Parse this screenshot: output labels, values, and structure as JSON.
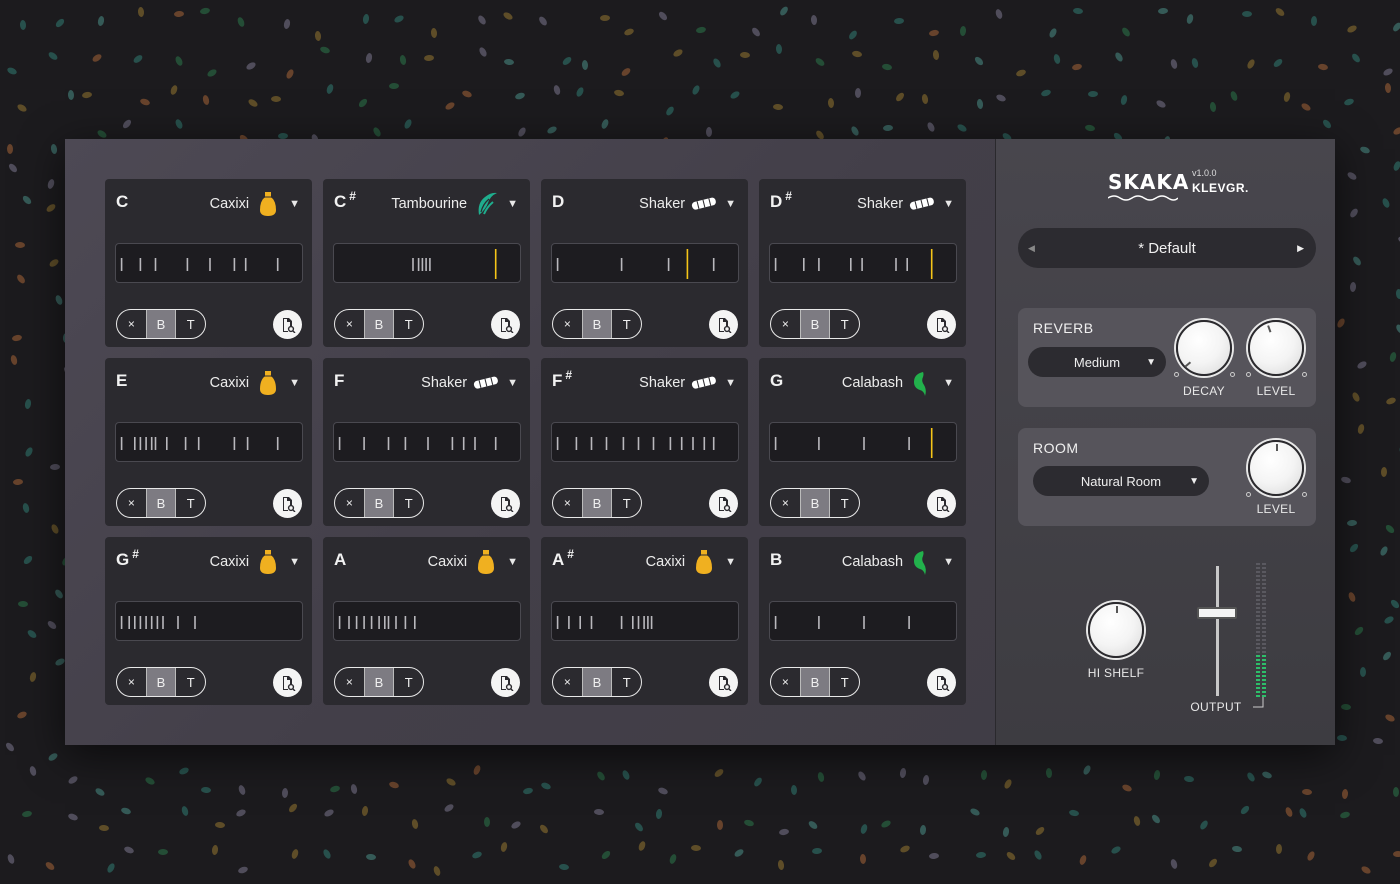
{
  "app": {
    "logo": "SKAKA",
    "version": "v1.0.0",
    "brand": "KLEVGR."
  },
  "preset": {
    "name": "* Default"
  },
  "pads": [
    {
      "note": "C",
      "sharp": "",
      "instrument": "Caxixi",
      "icon": "caxixi-icon",
      "color": "#f0b020",
      "ticks": [
        0.03,
        0.13,
        0.21,
        0.38,
        0.5,
        0.63,
        0.69,
        0.86
      ],
      "marker": null
    },
    {
      "note": "C",
      "sharp": "#",
      "instrument": "Tambourine",
      "icon": "tambourine-icon",
      "color": "#1fae8e",
      "ticks": [
        0.42,
        0.45,
        0.47,
        0.49,
        0.51
      ],
      "marker": 0.86
    },
    {
      "note": "D",
      "sharp": "",
      "instrument": "Shaker",
      "icon": "shaker-icon",
      "color": "#ffffff",
      "ticks": [
        0.03,
        0.37,
        0.62,
        0.86
      ],
      "marker": 0.72
    },
    {
      "note": "D",
      "sharp": "#",
      "instrument": "Shaker",
      "icon": "shaker-icon",
      "color": "#ffffff",
      "ticks": [
        0.03,
        0.18,
        0.26,
        0.43,
        0.49,
        0.67,
        0.73
      ],
      "marker": 0.86
    },
    {
      "note": "E",
      "sharp": "",
      "instrument": "Caxixi",
      "icon": "caxixi-icon",
      "color": "#f0b020",
      "ticks": [
        0.03,
        0.1,
        0.13,
        0.16,
        0.19,
        0.21,
        0.27,
        0.37,
        0.44,
        0.63,
        0.7,
        0.86
      ],
      "marker": null
    },
    {
      "note": "F",
      "sharp": "",
      "instrument": "Shaker",
      "icon": "shaker-icon",
      "color": "#ffffff",
      "ticks": [
        0.03,
        0.16,
        0.29,
        0.38,
        0.5,
        0.63,
        0.69,
        0.75,
        0.86
      ],
      "marker": null
    },
    {
      "note": "F",
      "sharp": "#",
      "instrument": "Shaker",
      "icon": "shaker-icon",
      "color": "#ffffff",
      "ticks": [
        0.03,
        0.13,
        0.21,
        0.29,
        0.38,
        0.46,
        0.54,
        0.63,
        0.69,
        0.75,
        0.81,
        0.86
      ],
      "marker": null
    },
    {
      "note": "G",
      "sharp": "",
      "instrument": "Calabash",
      "icon": "calabash-icon",
      "color": "#22b14c",
      "ticks": [
        0.03,
        0.26,
        0.5,
        0.74
      ],
      "marker": 0.86
    },
    {
      "note": "G",
      "sharp": "#",
      "instrument": "Caxixi",
      "icon": "caxixi-icon",
      "color": "#f0b020",
      "ticks": [
        0.03,
        0.07,
        0.1,
        0.13,
        0.16,
        0.19,
        0.22,
        0.25,
        0.33,
        0.42
      ],
      "marker": null
    },
    {
      "note": "A",
      "sharp": "",
      "instrument": "Caxixi",
      "icon": "caxixi-icon",
      "color": "#f0b020",
      "ticks": [
        0.03,
        0.08,
        0.12,
        0.16,
        0.2,
        0.24,
        0.27,
        0.29,
        0.33,
        0.38,
        0.43
      ],
      "marker": null
    },
    {
      "note": "A",
      "sharp": "#",
      "instrument": "Caxixi",
      "icon": "caxixi-icon",
      "color": "#f0b020",
      "ticks": [
        0.03,
        0.09,
        0.15,
        0.21,
        0.37,
        0.43,
        0.46,
        0.49,
        0.51,
        0.53
      ],
      "marker": null
    },
    {
      "note": "B",
      "sharp": "",
      "instrument": "Calabash",
      "icon": "calabash-icon",
      "color": "#22b14c",
      "ticks": [
        0.03,
        0.26,
        0.5,
        0.74
      ],
      "marker": null
    }
  ],
  "pad_buttons": {
    "mute": "×",
    "b": "B",
    "t": "T"
  },
  "reverb": {
    "title": "REVERB",
    "type": "Medium",
    "decay_label": "DECAY",
    "level_label": "LEVEL"
  },
  "room": {
    "title": "ROOM",
    "type": "Natural Room",
    "level_label": "LEVEL"
  },
  "hishelf": {
    "label": "HI SHELF"
  },
  "output": {
    "label": "OUTPUT"
  },
  "colors": {
    "accent": "#f5c518",
    "caxixi": "#f0b020",
    "tambourine": "#1fae8e",
    "calabash": "#22b14c"
  }
}
